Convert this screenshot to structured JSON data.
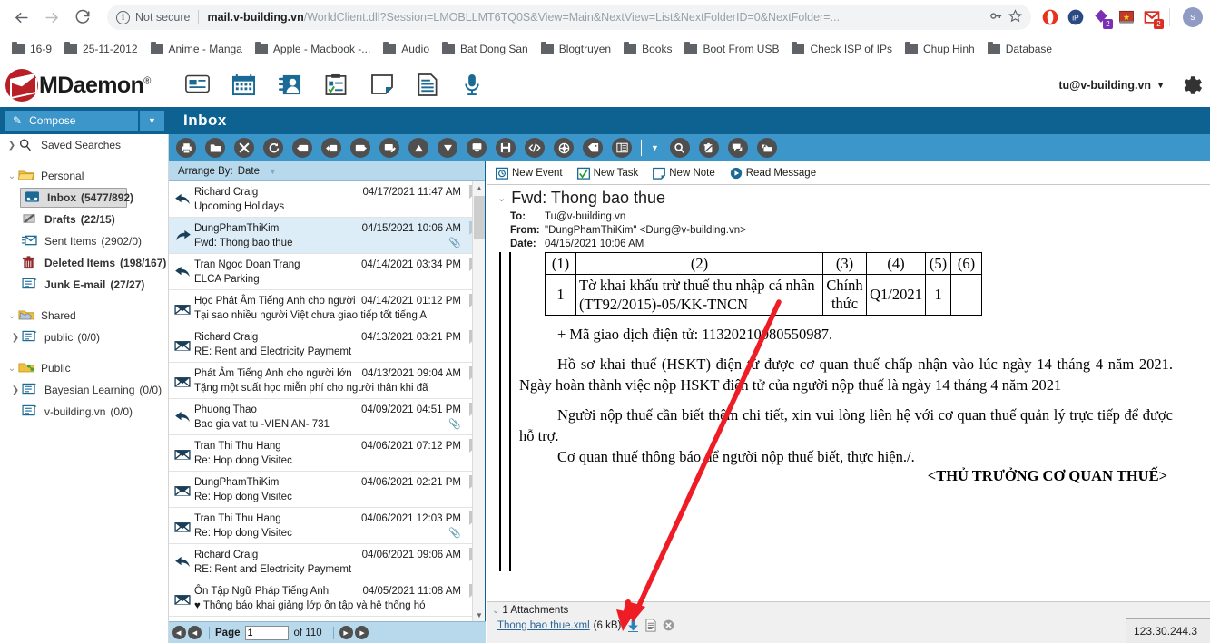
{
  "browser": {
    "back_icon": "back-arrow-icon",
    "forward_icon": "forward-arrow-icon",
    "reload_icon": "reload-icon",
    "security_label": "Not secure",
    "url_host": "mail.v-building.vn",
    "url_path": "/WorldClient.dll?Session=LMOBLLMT6TQ0S&View=Main&NextView=List&NextFolderID=0&NextFolder=...",
    "key_icon": "key-icon",
    "star_icon": "star-icon",
    "profile_initial": "s",
    "extensions": [
      {
        "name": "opera-extension-icon",
        "glyph": "O",
        "color": "#e8321c",
        "badge": ""
      },
      {
        "name": "ip-extension-icon",
        "glyph": "iP",
        "color": "#2b4a84",
        "badge": ""
      },
      {
        "name": "purple-extension-icon",
        "glyph": "◆",
        "color": "#7b2fb5",
        "badge": "2",
        "badge_color": "#7b2fb5"
      },
      {
        "name": "flag-extension-icon",
        "glyph": "■",
        "color": "#c0392b",
        "badge": ""
      },
      {
        "name": "gmail-extension-icon",
        "glyph": "M",
        "color": "#d93025",
        "badge": "2",
        "badge_color": "#d93025"
      }
    ],
    "bookmarks": [
      "16-9",
      "25-11-2012",
      "Anime - Manga",
      "Apple - Macbook -...",
      "Audio",
      "Bat Dong San",
      "Blogtruyen",
      "Books",
      "Boot From USB",
      "Check ISP of IPs",
      "Chup Hinh",
      "Database"
    ]
  },
  "app": {
    "brand": "MDaemon",
    "brand_sup": "®",
    "user_email": "tu@v-building.vn",
    "nav_icons": [
      "email-icon",
      "calendar-icon",
      "contacts-icon",
      "tasks-icon",
      "notes-icon",
      "documents-icon",
      "voicemail-icon"
    ],
    "gear_icon": "gear-icon"
  },
  "sidebar": {
    "compose_label": "Compose",
    "compose_dropdown_icon": "chevron-down-icon",
    "saved_searches": "Saved Searches",
    "groups": [
      {
        "name": "Personal",
        "items": [
          {
            "label": "Inbox",
            "count": "(5477/892)",
            "bold": true,
            "selected": true,
            "icon": "inbox-icon"
          },
          {
            "label": "Drafts",
            "count": "(22/15)",
            "bold": true,
            "selected": false,
            "icon": "drafts-icon"
          },
          {
            "label": "Sent Items",
            "count": "(2902/0)",
            "bold": false,
            "selected": false,
            "icon": "sent-icon"
          },
          {
            "label": "Deleted Items",
            "count": "(198/167)",
            "bold": true,
            "selected": false,
            "icon": "trash-icon"
          },
          {
            "label": "Junk E-mail",
            "count": "(27/27)",
            "bold": true,
            "selected": false,
            "icon": "junk-icon"
          }
        ]
      },
      {
        "name": "Shared",
        "items": [
          {
            "label": "public",
            "count": "(0/0)",
            "bold": false,
            "selected": false,
            "icon": "folder-icon",
            "expandable": true
          }
        ]
      },
      {
        "name": "Public",
        "items": [
          {
            "label": "Bayesian Learning",
            "count": "(0/0)",
            "bold": false,
            "selected": false,
            "icon": "folder-icon",
            "expandable": true
          },
          {
            "label": "v-building.vn",
            "count": "(0/0)",
            "bold": false,
            "selected": false,
            "icon": "folder-icon",
            "expandable": false
          }
        ]
      }
    ]
  },
  "header": {
    "folder_title": "Inbox"
  },
  "toolbar": {
    "icons": [
      "print-icon",
      "move-to-folder-icon",
      "delete-icon",
      "refresh-icon",
      "reply-icon",
      "reply-all-icon",
      "forward-icon",
      "edit-as-new-icon",
      "move-up-icon",
      "move-down-icon",
      "mark-read-icon",
      "save-icon",
      "view-source-icon",
      "redirect-icon",
      "tag-icon",
      "view-layout-icon"
    ],
    "dropdown_icon": "chevron-down-icon",
    "right_icons": [
      "search-icon",
      "empty-trash-icon",
      "spam-icon",
      "not-spam-icon"
    ]
  },
  "list": {
    "arrange_label": "Arrange By:",
    "arrange_value": "Date",
    "arrange_caret": "chevron-down-icon",
    "messages": [
      {
        "from": "Richard Craig",
        "date": "04/17/2021 11:47 AM",
        "subject": "Upcoming Holidays",
        "icon": "replied-icon",
        "attachment": false,
        "selected": false
      },
      {
        "from": "DungPhamThiKim",
        "date": "04/15/2021 10:06 AM",
        "subject": "Fwd: Thong bao thue",
        "icon": "forwarded-icon",
        "attachment": true,
        "selected": true
      },
      {
        "from": "Tran Ngoc Doan Trang",
        "date": "04/14/2021 03:34 PM",
        "subject": "ELCA Parking",
        "icon": "replied-icon",
        "attachment": false,
        "selected": false
      },
      {
        "from": "Học Phát Âm Tiếng Anh cho người",
        "date": "04/14/2021 01:12 PM",
        "subject": "Tại sao nhiều người Việt chưa giao tiếp tốt tiếng A",
        "icon": "unread-icon",
        "attachment": false,
        "selected": false
      },
      {
        "from": "Richard Craig",
        "date": "04/13/2021 03:21 PM",
        "subject": "RE: Rent and Electricity Paymemt",
        "icon": "unread-icon",
        "attachment": false,
        "selected": false
      },
      {
        "from": "Phát Âm Tiếng Anh cho người lớn",
        "date": "04/13/2021 09:04 AM",
        "subject": "Tặng một suất học miễn phí cho người thân khi đã",
        "icon": "unread-icon",
        "attachment": false,
        "selected": false
      },
      {
        "from": "Phuong Thao",
        "date": "04/09/2021 04:51 PM",
        "subject": "Bao gia vat tu -VIEN AN-  731",
        "icon": "replied-icon",
        "attachment": true,
        "selected": false
      },
      {
        "from": "Tran Thi Thu Hang",
        "date": "04/06/2021 07:12 PM",
        "subject": "Re: Hop dong Visitec",
        "icon": "unread-icon",
        "attachment": false,
        "selected": false
      },
      {
        "from": "DungPhamThiKim",
        "date": "04/06/2021 02:21 PM",
        "subject": "Re: Hop dong Visitec",
        "icon": "unread-icon",
        "attachment": false,
        "selected": false
      },
      {
        "from": "Tran Thi Thu Hang",
        "date": "04/06/2021 12:03 PM",
        "subject": "Re: Hop dong Visitec",
        "icon": "unread-icon",
        "attachment": true,
        "selected": false
      },
      {
        "from": "Richard Craig",
        "date": "04/06/2021 09:06 AM",
        "subject": "RE: Rent and Electricity Paymemt",
        "icon": "replied-icon",
        "attachment": false,
        "selected": false
      },
      {
        "from": "Ôn Tập Ngữ Pháp Tiếng Anh",
        "date": "04/05/2021 11:08 AM",
        "subject": "♥ Thông báo khai giảng lớp ôn tập và hệ thống hó",
        "icon": "unread-icon",
        "attachment": false,
        "selected": false
      }
    ],
    "pager": {
      "first_icon": "first-page-icon",
      "prev_icon": "prev-page-icon",
      "page_label": "Page",
      "page_value": "1",
      "of_label": "of 110",
      "next_icon": "next-page-icon",
      "last_icon": "last-page-icon"
    }
  },
  "preview": {
    "actions": [
      {
        "label": "New Event",
        "icon": "new-event-icon"
      },
      {
        "label": "New Task",
        "icon": "new-task-icon"
      },
      {
        "label": "New Note",
        "icon": "new-note-icon"
      },
      {
        "label": "Read Message",
        "icon": "read-message-icon"
      }
    ],
    "subject": "Fwd: Thong bao thue",
    "collapse_icon": "chevron-down-icon",
    "to_label": "To:",
    "to_value": "Tu@v-building.vn",
    "from_label": "From:",
    "from_value": "\"DungPhamThiKim\" <Dung@v-building.vn>",
    "date_label": "Date:",
    "date_value": "04/15/2021 10:06 AM",
    "body": {
      "table_headers": [
        "(1)",
        "(2)",
        "(3)",
        "(4)",
        "(5)",
        "(6)"
      ],
      "table_row": {
        "no": "1",
        "declaration": "Tờ khai khấu trừ thuế thu nhập cá nhân (TT92/2015)-05/KK-TNCN",
        "type": "Chính thức",
        "period": "Q1/2021",
        "times": "1",
        "note": ""
      },
      "line_code": "+ Mã giao dịch điện tử: 11320210080550987.",
      "para1": "Hồ sơ khai thuế (HSKT) điện tử được cơ quan thuế chấp nhận vào lúc ngày 14 tháng 4 năm 2021. Ngày hoàn thành việc nộp HSKT điện tử của người nộp thuế là ngày 14 tháng 4 năm 2021",
      "para2": "Người nộp thuế cần biết thêm chi tiết, xin vui lòng liên hệ với cơ quan thuế quản lý trực tiếp để được hỗ trợ.",
      "para3": "Cơ quan thuế thông báo để người nộp thuế biết, thực hiện./.",
      "signature": "<THỦ TRƯỞNG CƠ QUAN THUẾ>"
    },
    "attachments": {
      "header": "1 Attachments",
      "files": [
        {
          "name": "Thong bao thue.xml",
          "size": "(6 kB)",
          "download_icon": "download-icon",
          "view_icon": "view-file-icon",
          "remove_icon": "remove-attachment-icon"
        }
      ]
    }
  },
  "status": {
    "ip": "123.30.244.3"
  },
  "colors": {
    "brand_blue": "#0d6291",
    "toolbar_blue": "#3c96c9",
    "selection_blue": "#ddedf7",
    "arrange_blue": "#b8d9ec",
    "annotation_red": "#ee1c25"
  }
}
